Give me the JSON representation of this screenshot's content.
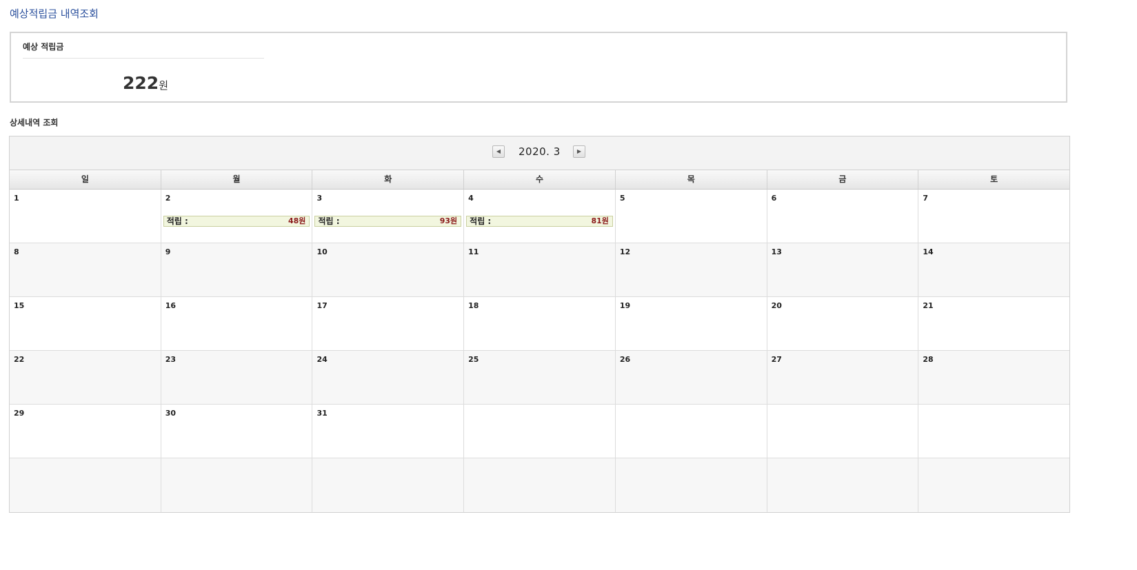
{
  "page": {
    "title": "예상적립금 내역조회"
  },
  "summary": {
    "label": "예상 적립금",
    "amount": "222",
    "unit": "원"
  },
  "detail": {
    "title": "상세내역 조회"
  },
  "calendar": {
    "month_label": "2020. 3",
    "weekdays": [
      "일",
      "월",
      "화",
      "수",
      "목",
      "금",
      "토"
    ],
    "weeks": [
      [
        "1",
        "2",
        "3",
        "4",
        "5",
        "6",
        "7"
      ],
      [
        "8",
        "9",
        "10",
        "11",
        "12",
        "13",
        "14"
      ],
      [
        "15",
        "16",
        "17",
        "18",
        "19",
        "20",
        "21"
      ],
      [
        "22",
        "23",
        "24",
        "25",
        "26",
        "27",
        "28"
      ],
      [
        "29",
        "30",
        "31",
        "",
        "",
        "",
        ""
      ],
      [
        "",
        "",
        "",
        "",
        "",
        "",
        ""
      ]
    ],
    "entries": [
      {
        "label": "적립 :",
        "amount": "48원"
      },
      {
        "label": "적립 :",
        "amount": "93원"
      },
      {
        "label": "적립 :",
        "amount": "81원"
      }
    ]
  }
}
